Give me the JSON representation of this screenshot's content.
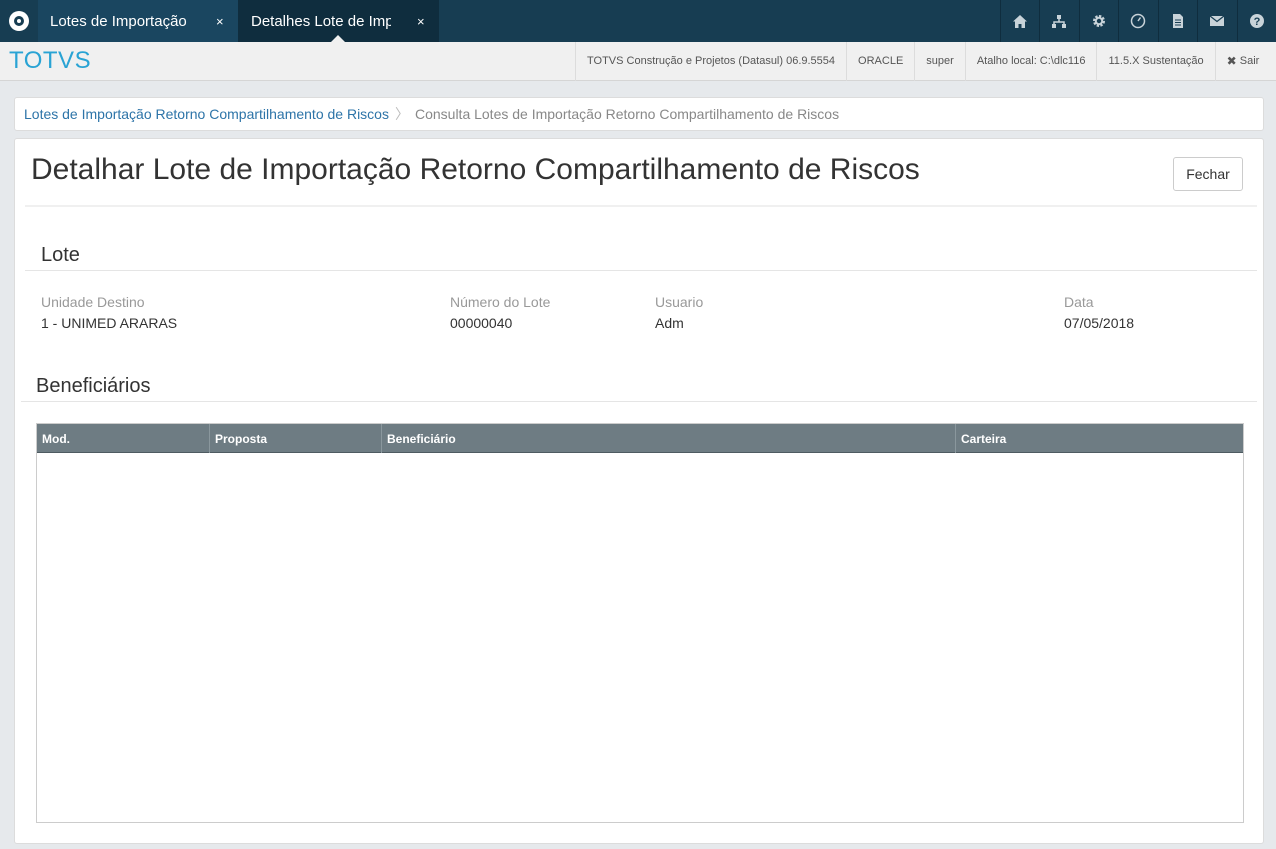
{
  "tabs": [
    {
      "label": "Lotes de Importação Retorno Compartilhamento de Riscos",
      "close": "×"
    },
    {
      "label": "Detalhes Lote de Importação",
      "close": "×"
    }
  ],
  "icons": [
    "home-icon",
    "sitemap-icon",
    "gear-icon",
    "clock-icon",
    "document-icon",
    "envelope-icon",
    "help-icon"
  ],
  "header": {
    "brand": "TOTVS",
    "product": "TOTVS Construção e Projetos (Datasul) 06.9.5554",
    "database": "ORACLE",
    "user": "super",
    "shortcut": "Atalho local: C:\\dlc116",
    "version": "11.5.X Sustentação",
    "logout": "Sair"
  },
  "breadcrumb": {
    "parent": "Lotes de Importação Retorno Compartilhamento de Riscos",
    "separator": "〉",
    "current": "Consulta Lotes de Importação Retorno Compartilhamento de Riscos"
  },
  "page": {
    "title": "Detalhar Lote de Importação Retorno Compartilhamento de Riscos",
    "close_label": "Fechar"
  },
  "lote": {
    "section_title": "Lote",
    "fields": [
      {
        "label": "Unidade Destino",
        "value": "1 - UNIMED ARARAS"
      },
      {
        "label": "Número do Lote",
        "value": "00000040"
      },
      {
        "label": "Usuario",
        "value": "Adm"
      },
      {
        "label": "Data",
        "value": "07/05/2018"
      }
    ]
  },
  "beneficiarios": {
    "section_title": "Beneficiários",
    "columns": [
      "Mod.",
      "Proposta",
      "Beneficiário",
      "Carteira"
    ]
  },
  "colors": {
    "topbar": "#173d52",
    "brand": "#29a3d4",
    "link": "#2d74a8",
    "grid_header": "#6e7c83"
  }
}
